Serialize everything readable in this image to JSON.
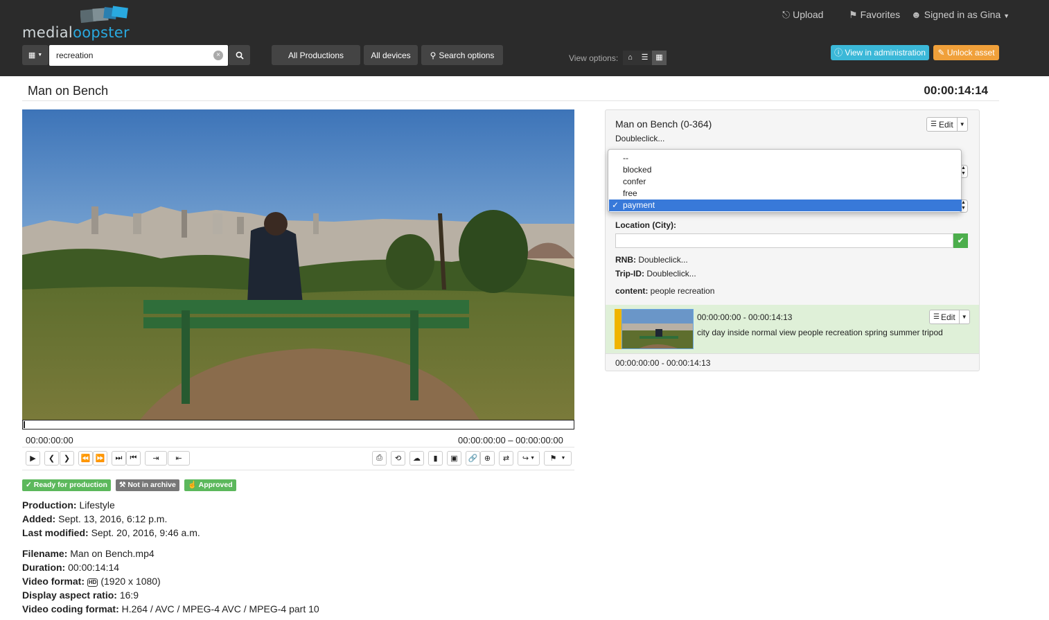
{
  "header": {
    "logo_part1": "media",
    "logo_part2": "l",
    "logo_part3": "oo",
    "logo_part4": "pster",
    "upload_label": "Upload",
    "favorites_label": "Favorites",
    "signed_in_label": "Signed in as Gina",
    "search_value": "recreation",
    "all_productions_label": "All Productions",
    "all_devices_label": "All devices",
    "search_options_label": "Search options",
    "view_options_label": "View options:",
    "view_admin_label": "View in administration",
    "unlock_label": "Unlock asset"
  },
  "asset": {
    "title": "Man on Bench",
    "duration": "00:00:14:14"
  },
  "player": {
    "current_time": "00:00:00:00",
    "range": "00:00:00:00 – 00:00:00:00"
  },
  "badges": {
    "ready": "Ready for production",
    "archive": "Not in archive",
    "approved": "Approved"
  },
  "details": {
    "production_label": "Production:",
    "production_value": "Lifestyle",
    "added_label": "Added:",
    "added_value": "Sept. 13, 2016, 6:12 p.m.",
    "modified_label": "Last modified:",
    "modified_value": "Sept. 20, 2016, 9:46 a.m.",
    "filename_label": "Filename:",
    "filename_value": "Man on Bench.mp4",
    "duration_label": "Duration:",
    "duration_value": "00:00:14:14",
    "format_label": "Video format:",
    "format_value": "(1920 x 1080)",
    "aspect_label": "Display aspect ratio:",
    "aspect_value": "16:9",
    "coding_label": "Video coding format:",
    "coding_value": "H.264 / AVC / MPEG-4 AVC / MPEG-4 part 10"
  },
  "panel": {
    "title": "Man on Bench (0-364)",
    "subtitle": "Doubleclick...",
    "edit_label": "Edit",
    "dropdown_options": [
      "--",
      "blocked",
      "confer",
      "free"
    ],
    "dropdown_selected": "payment",
    "location_label": "Location (City):",
    "rnb_label": "RNB:",
    "rnb_value": "Doubleclick...",
    "trip_label": "Trip-ID:",
    "trip_value": "Doubleclick...",
    "content_label": "content:",
    "content_value": "people recreation"
  },
  "segment": {
    "timecode": "00:00:00:00 - 00:00:14:13",
    "keywords": "city day inside normal view people recreation spring summer tripod",
    "edit_label": "Edit",
    "range": "00:00:00:00 - 00:00:14:13"
  },
  "colors": {
    "topbar": "#2b2b2b",
    "accent_blue": "#29a9e0",
    "info": "#3bb8d8",
    "warning": "#f0a03a",
    "success": "#5cb85c",
    "grey_badge": "#777777",
    "segment_bg": "#dff0d8",
    "marker": "#f0b400"
  }
}
